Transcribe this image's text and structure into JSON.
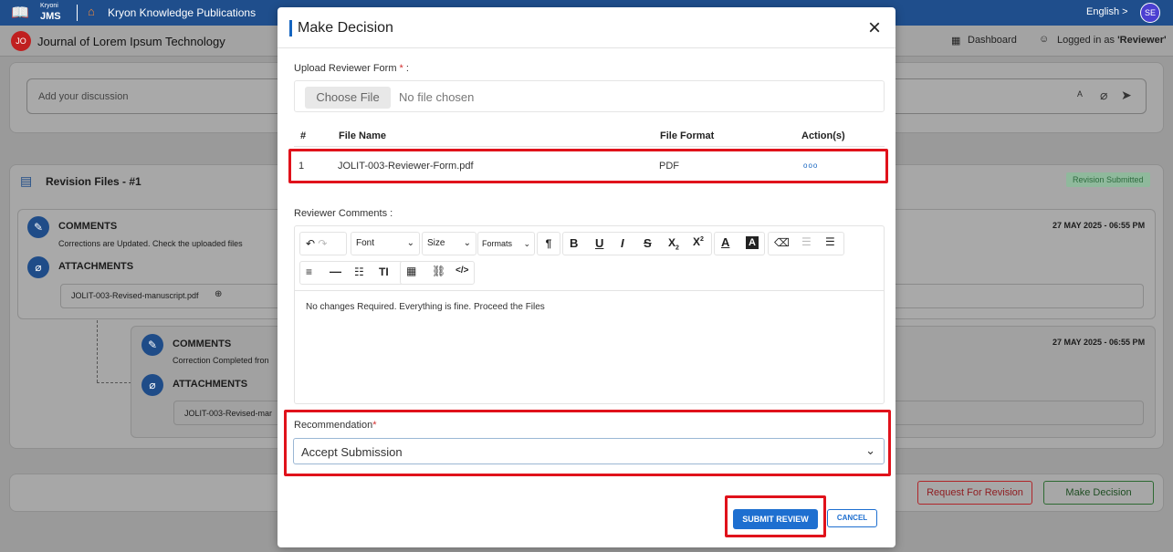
{
  "topbar": {
    "logo_small": "Kryoni",
    "logo_big": "JMS",
    "publisher": "Kryon Knowledge Publications",
    "language": "English >",
    "avatar": "SE"
  },
  "journal": {
    "badge": "JO",
    "title": "Journal of Lorem Ipsum Technology",
    "dashboard": "Dashboard",
    "logged_prefix": "Logged in as ",
    "logged_role": "'Reviewer'"
  },
  "discussion": {
    "placeholder": "Add your discussion"
  },
  "revision": {
    "title": "Revision Files - #1",
    "status": "Revision Submitted",
    "block1": {
      "comments_heading": "COMMENTS",
      "comment_text": "Corrections are  Updated. Check the uploaded files",
      "attachments_heading": "ATTACHMENTS",
      "file": "JOLIT-003-Revised-manuscript.pdf",
      "date": "27 MAY 2025 - 06:55 PM"
    },
    "block2": {
      "comments_heading": "COMMENTS",
      "comment_text": "Correction Completed fron",
      "attachments_heading": "ATTACHMENTS",
      "file": "JOLIT-003-Revised-mar",
      "date": "27 MAY 2025 - 06:55 PM"
    }
  },
  "actions": {
    "request_revision": "Request For Revision",
    "make_decision": "Make Decision"
  },
  "modal": {
    "title": "Make Decision",
    "upload_label": "Upload Reviewer Form",
    "upload_req": "*",
    "upload_colon": " :",
    "choose_file": "Choose File",
    "no_file": "No file chosen",
    "table": {
      "headers": [
        "#",
        "File Name",
        "File Format",
        "Action(s)"
      ],
      "rows": [
        {
          "num": "1",
          "name": "JOLIT-003-Reviewer-Form.pdf",
          "format": "PDF",
          "action": "ooo"
        }
      ]
    },
    "comments_label": "Reviewer Comments :",
    "toolbar": {
      "font": "Font",
      "size": "Size",
      "formats": "Formats"
    },
    "comment_text": "No changes Required. Everything is fine. Proceed the Files",
    "recommendation_label": "Recommendation",
    "recommendation_req": "*",
    "recommendation_value": "Accept Submission",
    "submit": "SUBMIT REVIEW",
    "cancel": "CANCEL"
  },
  "colors": {
    "primary": "#1e6fd0",
    "highlight": "#e0121b",
    "topbar": "#1f4e8c"
  }
}
